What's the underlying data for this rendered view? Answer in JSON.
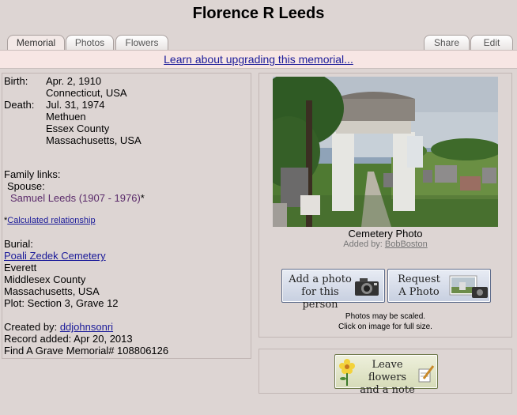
{
  "page": {
    "title": "Florence R Leeds"
  },
  "tabs": {
    "memorial": "Memorial",
    "photos": "Photos",
    "flowers": "Flowers",
    "share": "Share",
    "edit": "Edit"
  },
  "upgrade_link": "Learn about upgrading this memorial...",
  "person": {
    "birth_label": "Birth:",
    "birth_date": "Apr. 2, 1910",
    "birth_place": "Connecticut, USA",
    "death_label": "Death:",
    "death_date": "Jul. 31, 1974",
    "death_city": "Methuen",
    "death_county": "Essex County",
    "death_state": "Massachusetts, USA",
    "family_links_label": "Family links:",
    "spouse_label": "Spouse:",
    "spouse_name": "Samuel Leeds (1907 - 1976)",
    "spouse_marker": "*",
    "calc_prefix": "*",
    "calc_link": "Calculated relationship",
    "burial_label": "Burial:",
    "cemetery": "Poali Zedek Cemetery",
    "burial_city": "Everett",
    "burial_county": "Middlesex County",
    "burial_state": "Massachusetts, USA",
    "plot": "Plot: Section 3, Grave 12",
    "created_by_label": "Created by:",
    "created_by": "ddjohnsonri",
    "record_added": "Record added: Apr 20, 2013",
    "memorial_number": "Find A Grave Memorial# 108806126"
  },
  "photo": {
    "caption": "Cemetery Photo",
    "added_by_label": "Added by:",
    "added_by": "BobBoston",
    "scale_note_1": "Photos may be scaled.",
    "scale_note_2": "Click on image for full size."
  },
  "buttons": {
    "add_photo_line1": "Add a photo",
    "add_photo_line2": "for this person",
    "request_line1": "Request",
    "request_line2": "A Photo",
    "flowers_line1": "Leave flowers",
    "flowers_line2": "and a note"
  },
  "icons": [
    "camera-icon",
    "photo-thumbnail-icon",
    "flower-icon",
    "note-pencil-icon"
  ],
  "colors": {
    "background": "#ddd5d3",
    "link": "#1a1a99",
    "spouse": "#5a2a6a",
    "upgrade_bar": "#f7e6e4"
  }
}
